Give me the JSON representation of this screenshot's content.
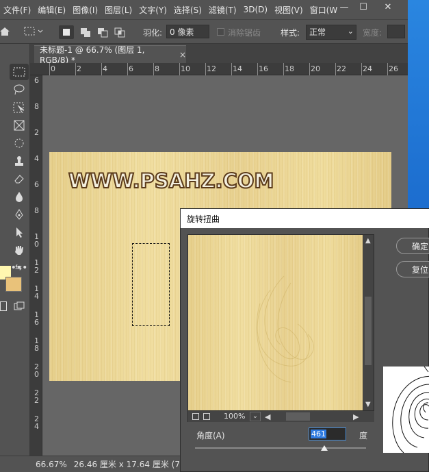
{
  "menubar": {
    "items": [
      "文件(F)",
      "编辑(E)",
      "图像(I)",
      "图层(L)",
      "文字(Y)",
      "选择(S)",
      "滤镜(T)",
      "3D(D)",
      "视图(V)",
      "窗口(W"
    ],
    "window_controls": [
      "—",
      "☐",
      "✕"
    ]
  },
  "options_bar": {
    "feather_label": "羽化:",
    "feather_value": "0 像素",
    "antialias_label": "消除锯齿",
    "style_label": "样式:",
    "style_value": "正常",
    "width_label": "宽度:"
  },
  "document_tab": {
    "title": "未标题-1 @ 66.7% (图层 1, RGB/8) *",
    "close": "×"
  },
  "ruler_top": [
    "0",
    "2",
    "4",
    "6",
    "8",
    "10",
    "12",
    "14",
    "16",
    "18",
    "20",
    "22",
    "24",
    "26"
  ],
  "ruler_left": [
    "6",
    "8",
    "2",
    "4",
    "6",
    "8",
    "1\n0",
    "1\n2",
    "1\n4",
    "1\n6",
    "1\n8",
    "2\n0",
    "2\n2",
    "2\n4"
  ],
  "canvas": {
    "watermark": "WWW.PSAHZ.COM"
  },
  "colors": {
    "foreground": "#fff7b0",
    "background": "#e9c27a"
  },
  "status_bar": {
    "zoom": "66.67%",
    "doc_size": "26.46 厘米 x 17.64 厘米 (72 ppi)",
    "arrow": "〉"
  },
  "dialog": {
    "title": "旋转扭曲",
    "ok_label": "确定",
    "reset_label": "复位",
    "preview_zoom": "100%",
    "angle_label": "角度(A)",
    "angle_value": "461",
    "angle_unit": "度",
    "angle_fraction": 0.756
  }
}
